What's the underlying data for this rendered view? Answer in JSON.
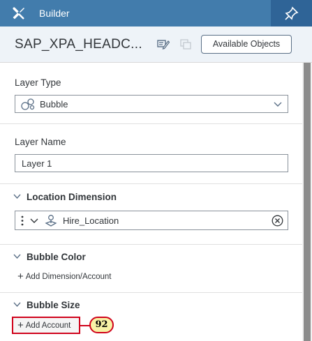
{
  "header": {
    "title": "Builder",
    "tools_icon": "tools-icon",
    "pin_icon": "pin-icon"
  },
  "model": {
    "name": "SAP_XPA_HEADC...",
    "edit_icon": "edit-icon",
    "copy_icon": "copy-icon",
    "available_objects_label": "Available Objects"
  },
  "layer_type": {
    "label": "Layer Type",
    "value": "Bubble",
    "icon": "bubble-icon"
  },
  "layer_name": {
    "label": "Layer Name",
    "value": "Layer 1"
  },
  "location_dimension": {
    "heading": "Location Dimension",
    "value": "Hire_Location",
    "icon": "location-icon"
  },
  "bubble_color": {
    "heading": "Bubble Color",
    "add_label": "Add Dimension/Account"
  },
  "bubble_size": {
    "heading": "Bubble Size",
    "add_label": "Add Account"
  },
  "callout": {
    "number": "92",
    "color": "#d0021b",
    "fill": "#f8f2a6"
  },
  "colors": {
    "header": "#427cac",
    "header_dark": "#2f6497",
    "subheader": "#eef3f8"
  }
}
